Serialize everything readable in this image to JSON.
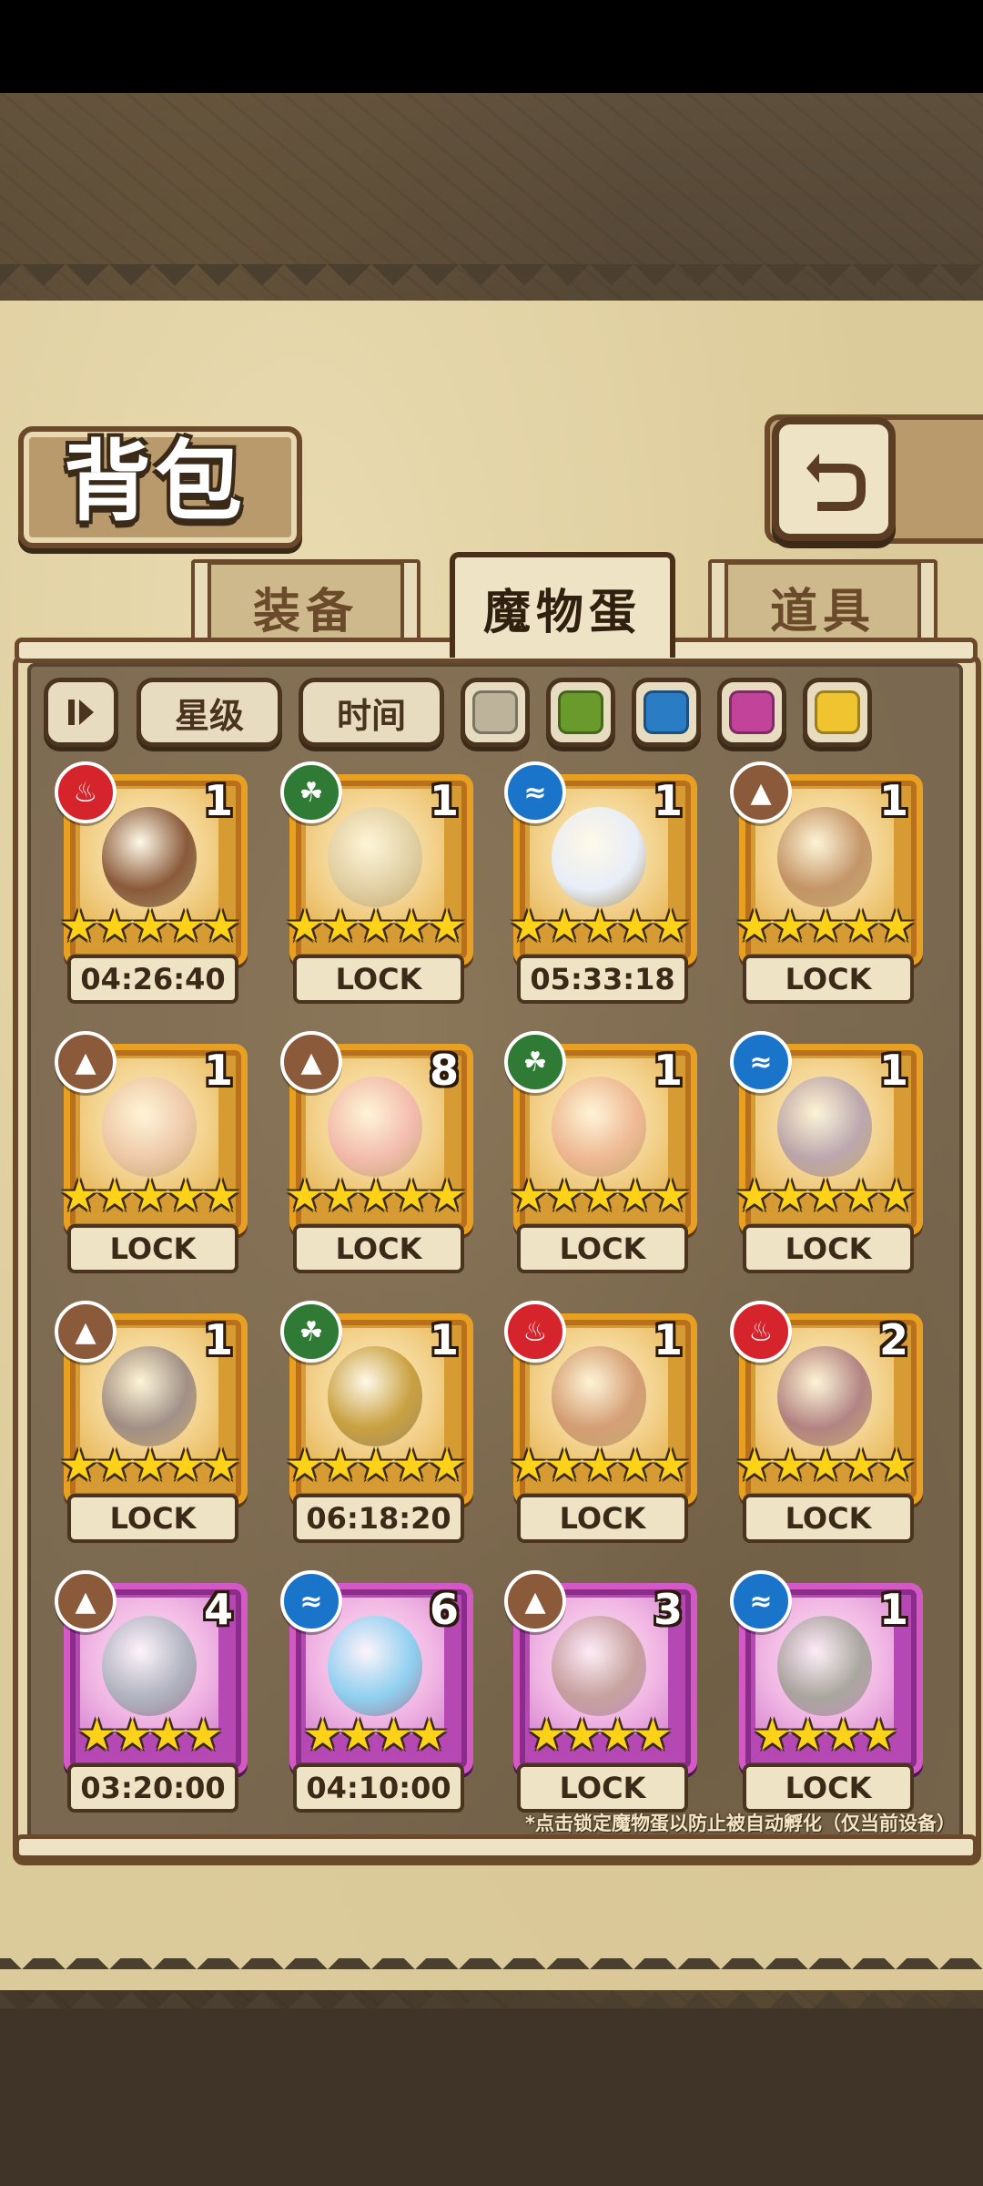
{
  "title": "背包",
  "tabs": [
    {
      "label": "装备",
      "active": false
    },
    {
      "label": "魔物蛋",
      "active": true
    },
    {
      "label": "道具",
      "active": false
    }
  ],
  "filters": {
    "sort_icon": "sort-toggle-icon",
    "star_label": "星级",
    "time_label": "时间",
    "color_swatches": [
      {
        "name": "gray",
        "color": "#bdb39a"
      },
      {
        "name": "green",
        "color": "#6a9a2c"
      },
      {
        "name": "blue",
        "color": "#2a7cc4"
      },
      {
        "name": "pink",
        "color": "#c2449a"
      },
      {
        "name": "yellow",
        "color": "#f0c330"
      }
    ]
  },
  "eggs": [
    {
      "element": "fire",
      "art": "bow-and-quiver-egg",
      "count": "1",
      "stars": 5,
      "rarity": "orange",
      "status": "04:26:40",
      "locked": false,
      "color": "#8a5a3a"
    },
    {
      "element": "leaf",
      "art": "laurel-egg",
      "count": "1",
      "stars": 5,
      "rarity": "orange",
      "status": "LOCK",
      "locked": true,
      "color": "#cfc6a8"
    },
    {
      "element": "water",
      "art": "ribbon-hat-egg",
      "count": "1",
      "stars": 5,
      "rarity": "orange",
      "status": "05:33:18",
      "locked": false,
      "color": "#e8eef8"
    },
    {
      "element": "earth",
      "art": "beetle-egg",
      "count": "1",
      "stars": 5,
      "rarity": "orange",
      "status": "LOCK",
      "locked": true,
      "color": "#9a5a3a"
    },
    {
      "element": "earth",
      "art": "heart-egg",
      "count": "1",
      "stars": 5,
      "rarity": "orange",
      "status": "LOCK",
      "locked": true,
      "color": "#e8b8b0"
    },
    {
      "element": "earth",
      "art": "bunny-donut-egg",
      "count": "8",
      "stars": 5,
      "rarity": "orange",
      "status": "LOCK",
      "locked": true,
      "color": "#f0a0b8"
    },
    {
      "element": "leaf",
      "art": "pig-egg",
      "count": "1",
      "stars": 5,
      "rarity": "orange",
      "status": "LOCK",
      "locked": true,
      "color": "#e89a88"
    },
    {
      "element": "water",
      "art": "pocket-watch-egg",
      "count": "1",
      "stars": 5,
      "rarity": "orange",
      "status": "LOCK",
      "locked": true,
      "color": "#8a7ab8"
    },
    {
      "element": "earth",
      "art": "rock-egg",
      "count": "1",
      "stars": 5,
      "rarity": "orange",
      "status": "LOCK",
      "locked": true,
      "color": "#5a5070"
    },
    {
      "element": "leaf",
      "art": "magic-lamp-egg",
      "count": "1",
      "stars": 5,
      "rarity": "orange",
      "status": "06:18:20",
      "locked": false,
      "color": "#c9a040"
    },
    {
      "element": "fire",
      "art": "horned-egg",
      "count": "1",
      "stars": 5,
      "rarity": "orange",
      "status": "LOCK",
      "locked": true,
      "color": "#b86a50"
    },
    {
      "element": "fire",
      "art": "orb-egg",
      "count": "2",
      "stars": 5,
      "rarity": "orange",
      "status": "LOCK",
      "locked": true,
      "color": "#7a3a6a"
    },
    {
      "element": "earth",
      "art": "sword-egg",
      "count": "4",
      "stars": 4,
      "rarity": "purple",
      "status": "03:20:00",
      "locked": false,
      "color": "#b0b4c0"
    },
    {
      "element": "water",
      "art": "slime-egg",
      "count": "6",
      "stars": 4,
      "rarity": "purple",
      "status": "04:10:00",
      "locked": false,
      "color": "#8fd0f0"
    },
    {
      "element": "earth",
      "art": "thorn-nest-egg",
      "count": "3",
      "stars": 4,
      "rarity": "purple",
      "status": "LOCK",
      "locked": true,
      "color": "#a08060"
    },
    {
      "element": "water",
      "art": "bone-egg",
      "count": "1",
      "stars": 4,
      "rarity": "purple",
      "status": "LOCK",
      "locked": true,
      "color": "#6a8a60"
    }
  ],
  "footnote": "*点击锁定魔物蛋以防止被自动孵化（仅当前设备）"
}
